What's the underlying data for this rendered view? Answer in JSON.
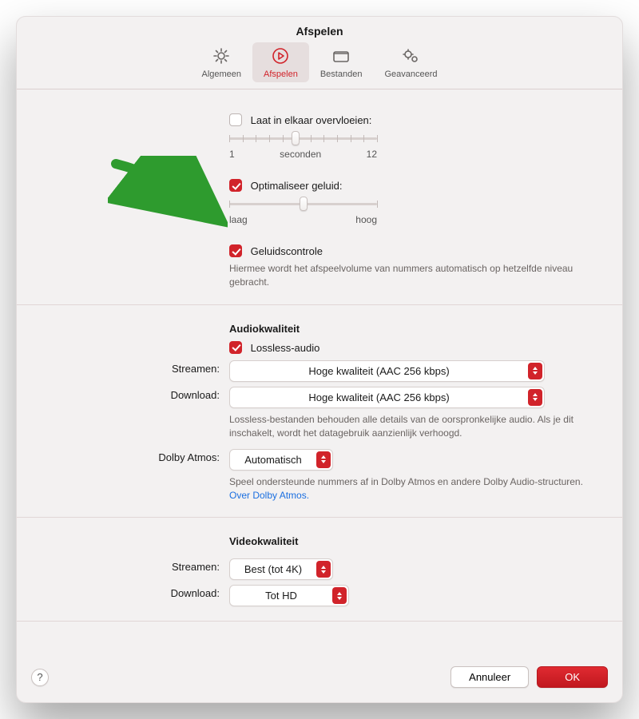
{
  "title": "Afspelen",
  "tabs": {
    "general": "Algemeen",
    "playback": "Afspelen",
    "files": "Bestanden",
    "advanced": "Geavanceerd"
  },
  "crossfade": {
    "label": "Laat in elkaar overvloeien:",
    "left": "1",
    "center": "seconden",
    "right": "12"
  },
  "optimize": {
    "label": "Optimaliseer geluid:",
    "left": "laag",
    "right": "hoog"
  },
  "soundcheck": {
    "label": "Geluidscontrole",
    "desc": "Hiermee wordt het afspeelvolume van nummers automatisch op hetzelfde niveau gebracht."
  },
  "audio": {
    "header": "Audiokwaliteit",
    "lossless_label": "Lossless-audio",
    "stream_label": "Streamen:",
    "stream_value": "Hoge kwaliteit (AAC 256 kbps)",
    "download_label": "Download:",
    "download_value": "Hoge kwaliteit (AAC 256 kbps)",
    "lossless_desc": "Lossless-bestanden behouden alle details van de oorspronkelijke audio. Als je dit inschakelt, wordt het datagebruik aanzienlijk verhoogd.",
    "dolby_label": "Dolby Atmos:",
    "dolby_value": "Automatisch",
    "dolby_desc": "Speel ondersteunde nummers af in Dolby Atmos en andere Dolby Audio-structuren. ",
    "dolby_link": "Over Dolby Atmos."
  },
  "video": {
    "header": "Videokwaliteit",
    "stream_label": "Streamen:",
    "stream_value": "Best (tot 4K)",
    "download_label": "Download:",
    "download_value": "Tot HD"
  },
  "footer": {
    "cancel": "Annuleer",
    "ok": "OK",
    "help": "?"
  },
  "accent": "#d1232a"
}
